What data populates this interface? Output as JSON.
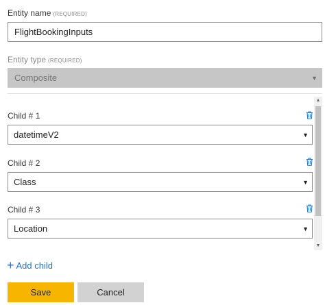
{
  "entity_name": {
    "label": "Entity name",
    "required": "(REQUIRED)",
    "value": "FlightBookingInputs"
  },
  "entity_type": {
    "label": "Entity type",
    "required": "(REQUIRED)",
    "value": "Composite"
  },
  "children": [
    {
      "label": "Child # 1",
      "value": "datetimeV2"
    },
    {
      "label": "Child # 2",
      "value": "Class"
    },
    {
      "label": "Child # 3",
      "value": "Location"
    }
  ],
  "add_child": {
    "icon": "plus-icon",
    "label": "Add child"
  },
  "buttons": {
    "save": "Save",
    "cancel": "Cancel"
  },
  "colors": {
    "accent": "#f7b500",
    "link": "#1e6fcf",
    "trash_icon": "#1e6fcf",
    "disabled_bg": "#c6c6c6"
  }
}
